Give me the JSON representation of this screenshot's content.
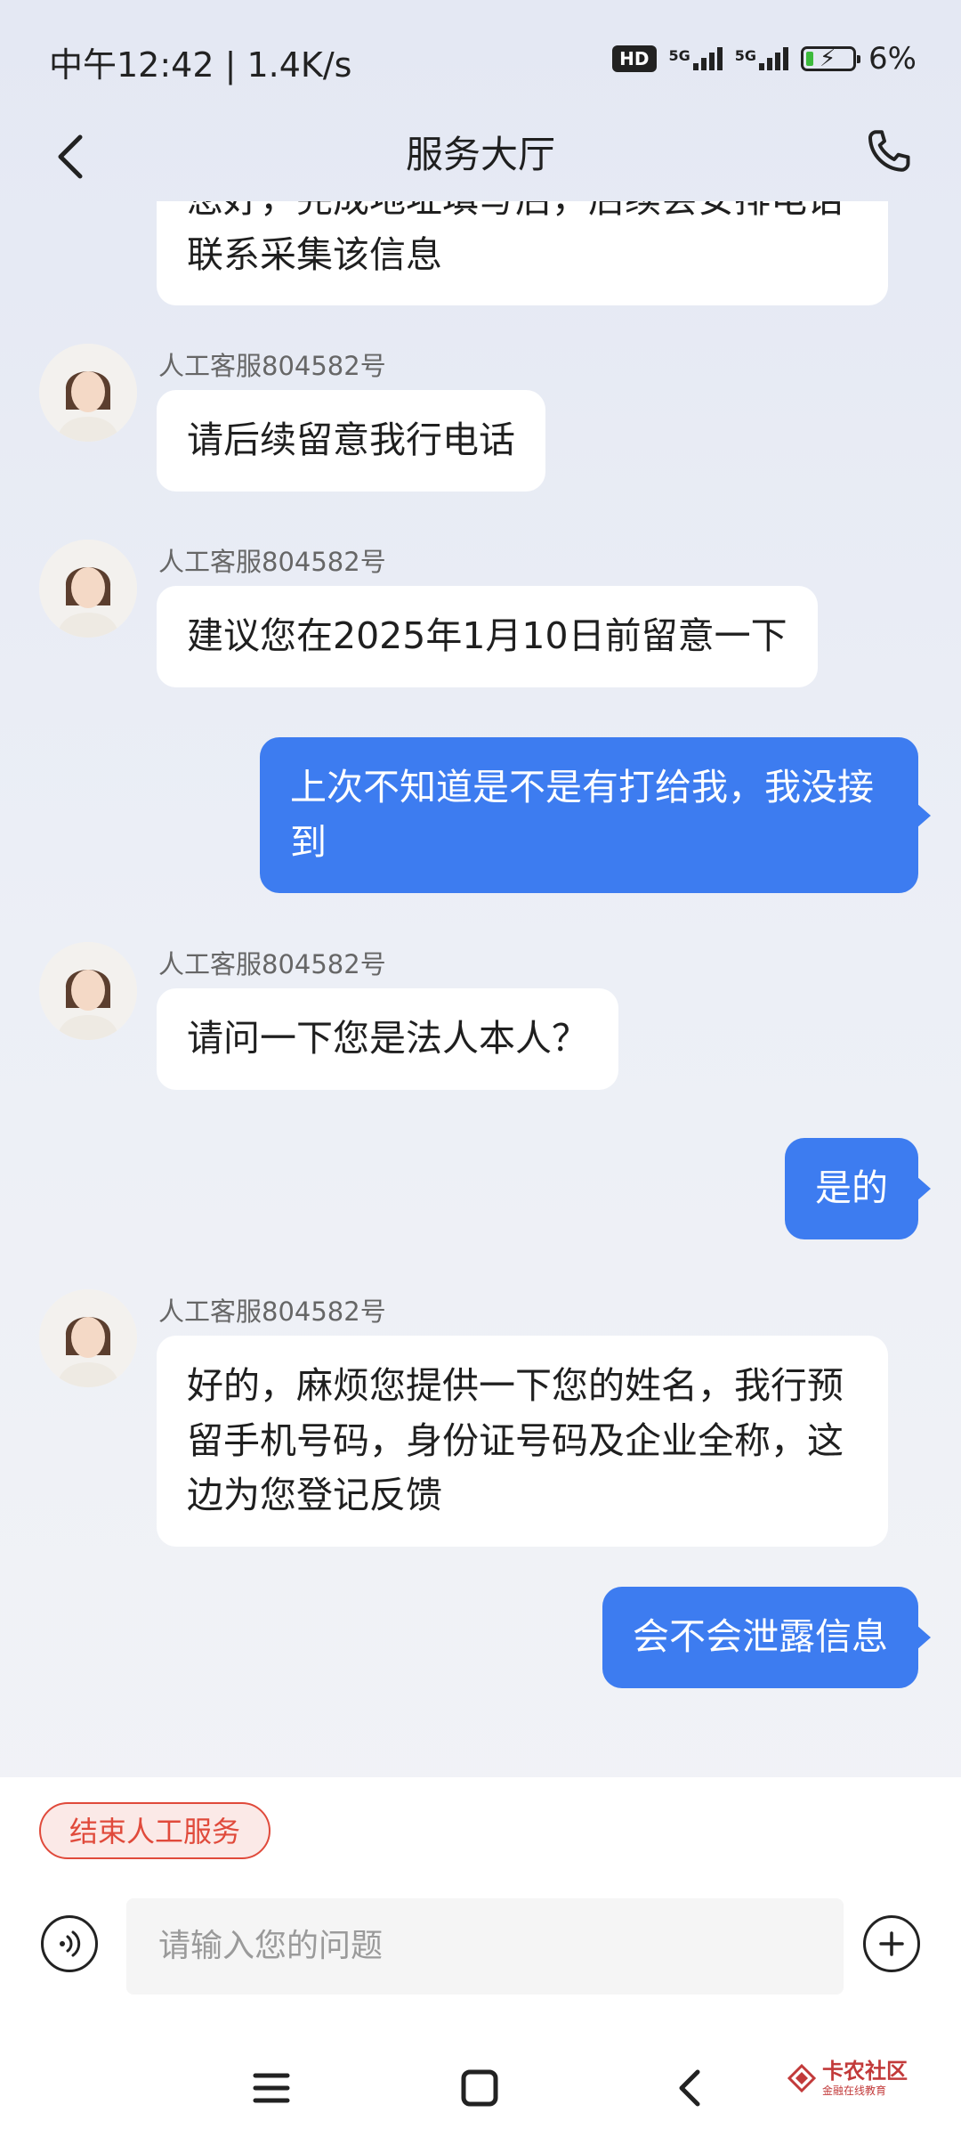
{
  "status_bar": {
    "time_speed": "中午12:42 | 1.4K/s",
    "hd_label": "HD",
    "net_label": "5G",
    "battery_pct": "6%",
    "battery_level": 0.06
  },
  "header": {
    "title": "服务大厅"
  },
  "messages": [
    {
      "from": "agent",
      "text": "您好，完成地址填写后，后续会安排电话联系采集该信息"
    },
    {
      "from": "agent",
      "name": "人工客服804582号",
      "text": "请后续留意我行电话"
    },
    {
      "from": "agent",
      "name": "人工客服804582号",
      "text": "建议您在2025年1月10日前留意一下"
    },
    {
      "from": "user",
      "text": "上次不知道是不是有打给我，我没接到"
    },
    {
      "from": "agent",
      "name": "人工客服804582号",
      "text": "请问一下您是法人本人？"
    },
    {
      "from": "user",
      "text": "是的"
    },
    {
      "from": "agent",
      "name": "人工客服804582号",
      "text": "好的，麻烦您提供一下您的姓名，我行预留手机号码，身份证号码及企业全称，这边为您登记反馈"
    },
    {
      "from": "user",
      "text": "会不会泄露信息"
    }
  ],
  "bottom": {
    "end_service_label": "结束人工服务",
    "input_placeholder": "请输入您的问题"
  },
  "watermark": {
    "main": "卡农社区",
    "sub": "金融在线教育"
  },
  "colors": {
    "user_bubble": "#3d7cf0",
    "end_button": "#e04a3b"
  }
}
